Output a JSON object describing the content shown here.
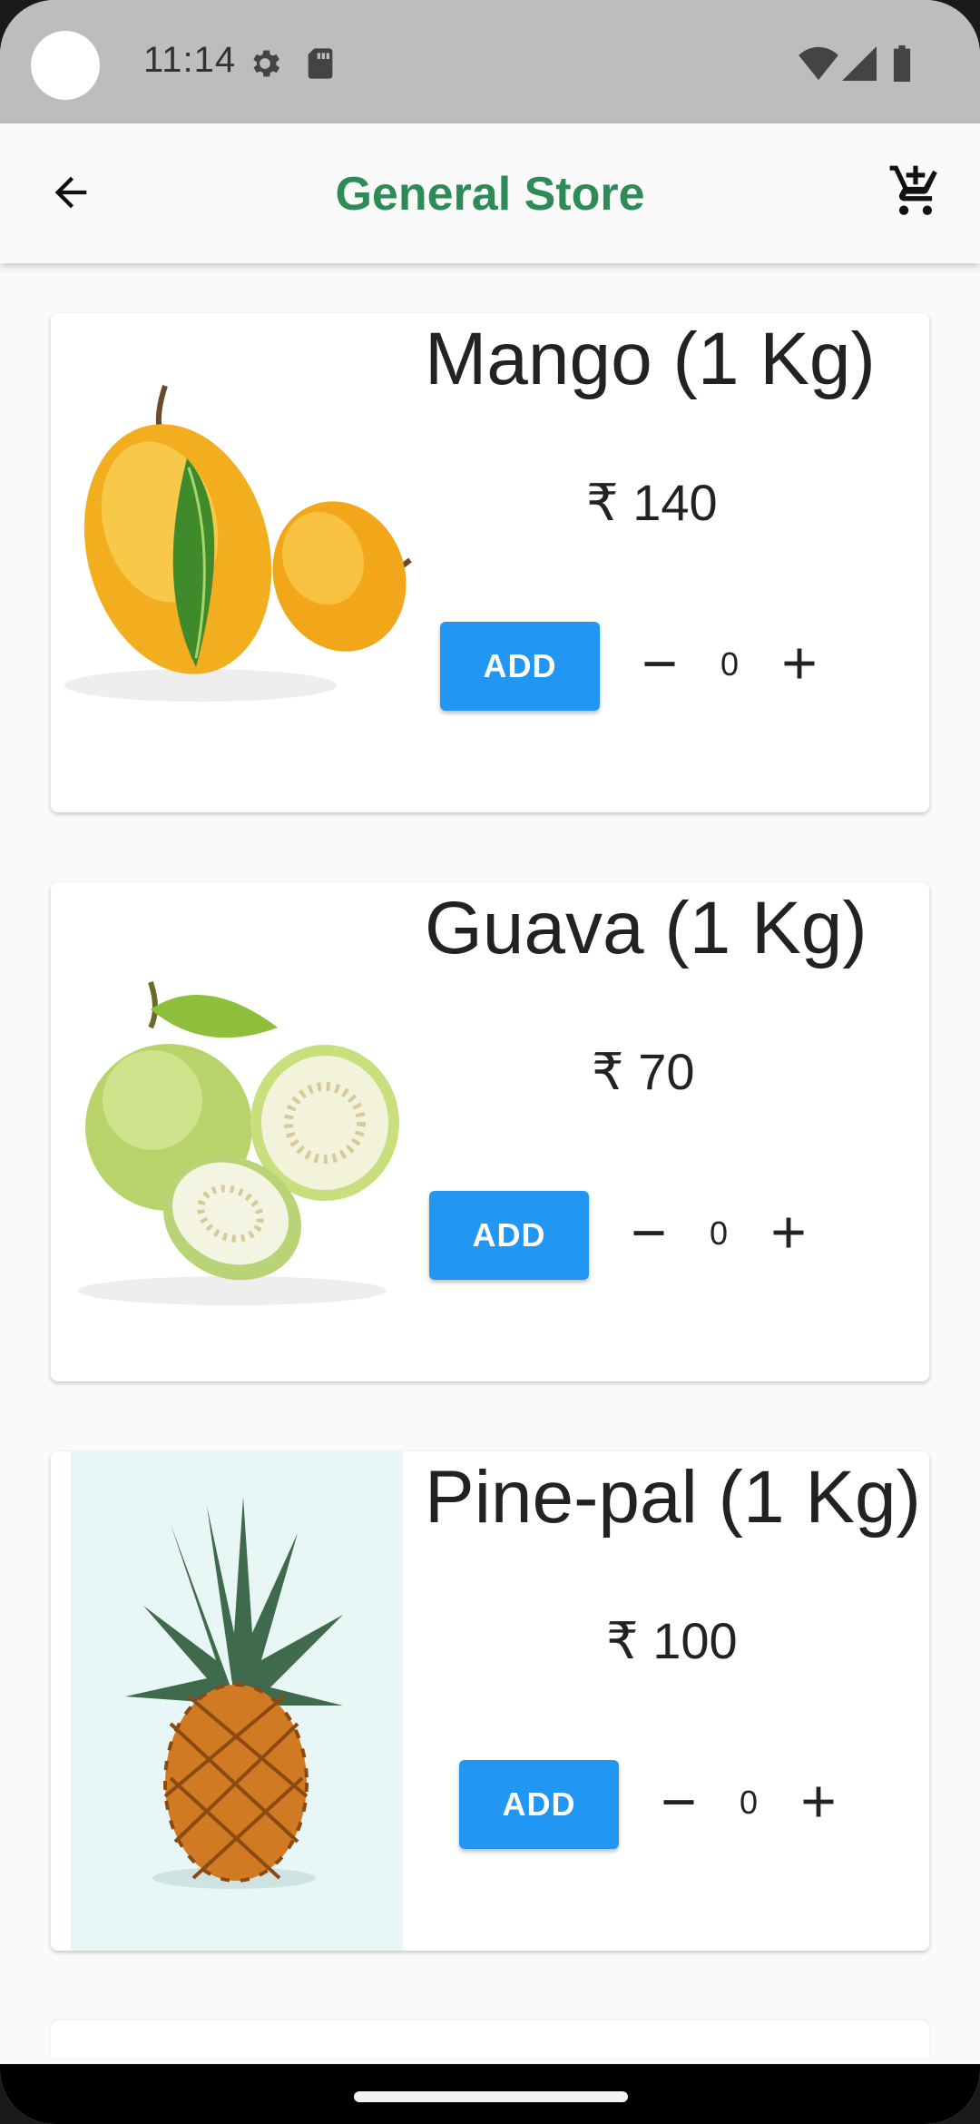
{
  "status_bar": {
    "time": "11:14",
    "icons": [
      "gear-icon",
      "sd-card-icon",
      "wifi-icon",
      "signal-icon",
      "battery-icon"
    ]
  },
  "app_bar": {
    "title": "General Store",
    "back_icon": "arrow-back-icon",
    "cart_icon": "add-shopping-cart-icon",
    "title_color": "#2e8b57"
  },
  "products": [
    {
      "name": "Mango (1 Kg)",
      "price": "₹ 140",
      "add_label": "ADD",
      "quantity": "0",
      "image": "mango-image"
    },
    {
      "name": "Guava (1 Kg)",
      "price": "₹ 70",
      "add_label": "ADD",
      "quantity": "0",
      "image": "guava-image"
    },
    {
      "name": "Pine-pal (1 Kg)",
      "price": "₹ 100",
      "add_label": "ADD",
      "quantity": "0",
      "image": "pineapple-image"
    }
  ],
  "colors": {
    "accent": "#2196f3",
    "status_bar": "#bdbdbd",
    "background": "#fafafa"
  }
}
